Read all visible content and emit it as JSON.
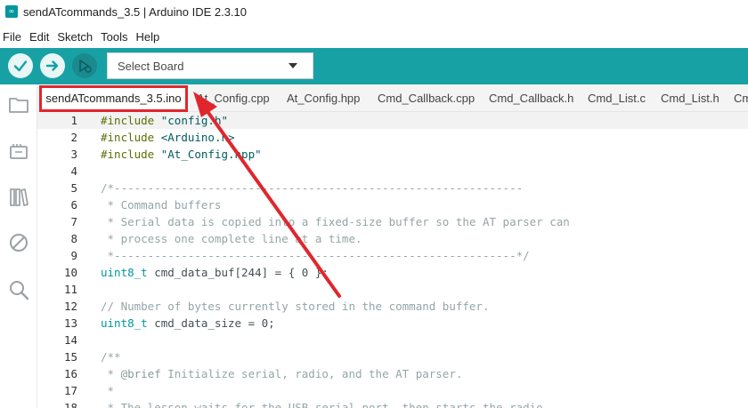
{
  "window": {
    "title": "sendATcommands_3.5 | Arduino IDE 2.3.10",
    "icon": "arduino-logo-icon"
  },
  "menu": [
    "File",
    "Edit",
    "Sketch",
    "Tools",
    "Help"
  ],
  "toolbar": {
    "verify_icon": "checkmark-icon",
    "upload_icon": "arrow-right-icon",
    "debug_icon": "debug-icon",
    "board_select_label": "Select Board",
    "accent_color": "#17a1a5"
  },
  "sidebar": [
    "folder-icon",
    "board-manager-icon",
    "library-icon",
    "debug-disabled-icon",
    "search-icon"
  ],
  "tabs": [
    {
      "label": "sendATcommands_3.5.ino",
      "active": true
    },
    {
      "label": "At_Config.cpp",
      "active": false
    },
    {
      "label": "At_Config.hpp",
      "active": false
    },
    {
      "label": "Cmd_Callback.cpp",
      "active": false
    },
    {
      "label": "Cmd_Callback.h",
      "active": false
    },
    {
      "label": "Cmd_List.c",
      "active": false
    },
    {
      "label": "Cmd_List.h",
      "active": false
    },
    {
      "label": "Cm",
      "active": false
    }
  ],
  "editor": {
    "current_line": 1,
    "lines": [
      {
        "n": "1",
        "tokens": [
          [
            "kw",
            "#include"
          ],
          [
            "plain",
            " "
          ],
          [
            "str",
            "\"config.h\""
          ]
        ]
      },
      {
        "n": "2",
        "tokens": [
          [
            "kw",
            "#include"
          ],
          [
            "plain",
            " "
          ],
          [
            "str",
            "<Arduino.h>"
          ]
        ]
      },
      {
        "n": "3",
        "tokens": [
          [
            "kw",
            "#include"
          ],
          [
            "plain",
            " "
          ],
          [
            "str",
            "\"At_Config.hpp\""
          ]
        ]
      },
      {
        "n": "4",
        "tokens": []
      },
      {
        "n": "5",
        "tokens": [
          [
            "cm",
            "/*-------------------------------------------------------------"
          ]
        ]
      },
      {
        "n": "6",
        "tokens": [
          [
            "cm",
            " * Command buffers"
          ]
        ]
      },
      {
        "n": "7",
        "tokens": [
          [
            "cm",
            " * Serial data is copied into a fixed-size buffer so the AT parser can"
          ]
        ]
      },
      {
        "n": "8",
        "tokens": [
          [
            "cm",
            " * process one complete line at a time."
          ]
        ]
      },
      {
        "n": "9",
        "tokens": [
          [
            "cm",
            " *------------------------------------------------------------*/"
          ]
        ]
      },
      {
        "n": "10",
        "tokens": [
          [
            "type",
            "uint8_t"
          ],
          [
            "plain",
            " cmd_data_buf[244] = { 0 };"
          ]
        ]
      },
      {
        "n": "11",
        "tokens": []
      },
      {
        "n": "12",
        "tokens": [
          [
            "cm",
            "// Number of bytes currently stored in the command buffer."
          ]
        ]
      },
      {
        "n": "13",
        "tokens": [
          [
            "type",
            "uint8_t"
          ],
          [
            "plain",
            " cmd_data_size = 0;"
          ]
        ]
      },
      {
        "n": "14",
        "tokens": []
      },
      {
        "n": "15",
        "tokens": [
          [
            "cm",
            "/**"
          ]
        ]
      },
      {
        "n": "16",
        "tokens": [
          [
            "cm",
            " * "
          ],
          [
            "doc",
            "@brief"
          ],
          [
            "cm",
            " Initialize serial, radio, and the AT parser."
          ]
        ]
      },
      {
        "n": "17",
        "tokens": [
          [
            "cm",
            " *"
          ]
        ]
      },
      {
        "n": "18",
        "tokens": [
          [
            "cm",
            " * The lesson waits for the USB serial port, then starts the radio"
          ]
        ]
      }
    ]
  },
  "annotation": {
    "highlight_color": "#e0262d"
  }
}
